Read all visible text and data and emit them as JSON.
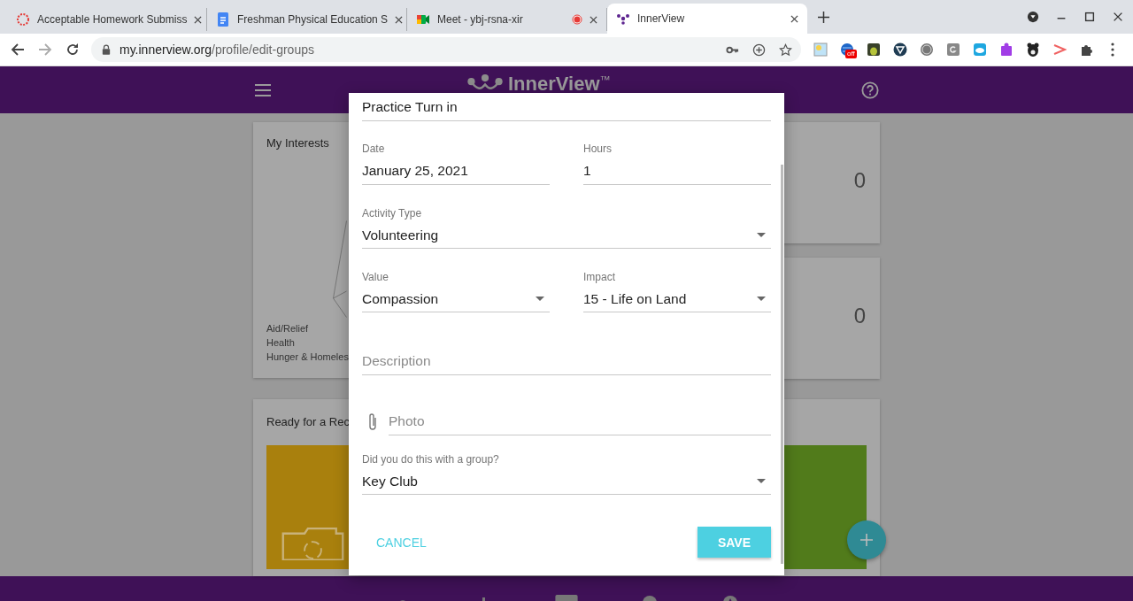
{
  "browser": {
    "tabs": [
      {
        "title": "Acceptable Homework Submiss",
        "kind": "sync",
        "selected": false,
        "recording": false
      },
      {
        "title": "Freshman Physical Education S",
        "kind": "docs",
        "selected": false,
        "recording": false
      },
      {
        "title": "Meet - ybj-rsna-xir",
        "kind": "meet",
        "selected": false,
        "recording": true
      },
      {
        "title": "InnerView",
        "kind": "innerview",
        "selected": true,
        "recording": false
      }
    ],
    "url_host": "my.innerview.org",
    "url_path": "/profile/edit-groups",
    "extension_badge": "off"
  },
  "header": {
    "logo": "InnerView",
    "trademark": "™"
  },
  "background": {
    "interests_title": "My Interests",
    "interests": [
      "Aid/Relief",
      "Health",
      "Hunger & Homeles"
    ],
    "stats": [
      "0",
      "0"
    ],
    "ready_title": "Ready for a Rec"
  },
  "dialog": {
    "rows": [
      [
        {
          "kind": "text",
          "value": "Practice Turn in"
        }
      ],
      [
        {
          "kind": "text",
          "label": "Date",
          "value": "January 25, 2021"
        },
        {
          "kind": "text",
          "label": "Hours",
          "value": "1"
        }
      ],
      [
        {
          "kind": "select",
          "label": "Activity Type",
          "value": "Volunteering"
        }
      ],
      [
        {
          "kind": "select",
          "label": "Value",
          "value": "Compassion"
        },
        {
          "kind": "select",
          "label": "Impact",
          "value": "15 - Life on Land"
        }
      ],
      [
        {
          "kind": "text",
          "placeholder": "Description"
        }
      ],
      [
        {
          "kind": "file",
          "placeholder": "Photo"
        }
      ],
      [
        {
          "kind": "select",
          "label": "Did you do this with a group?",
          "value": "Key Club"
        }
      ]
    ],
    "cancel": "CANCEL",
    "save": "SAVE"
  }
}
